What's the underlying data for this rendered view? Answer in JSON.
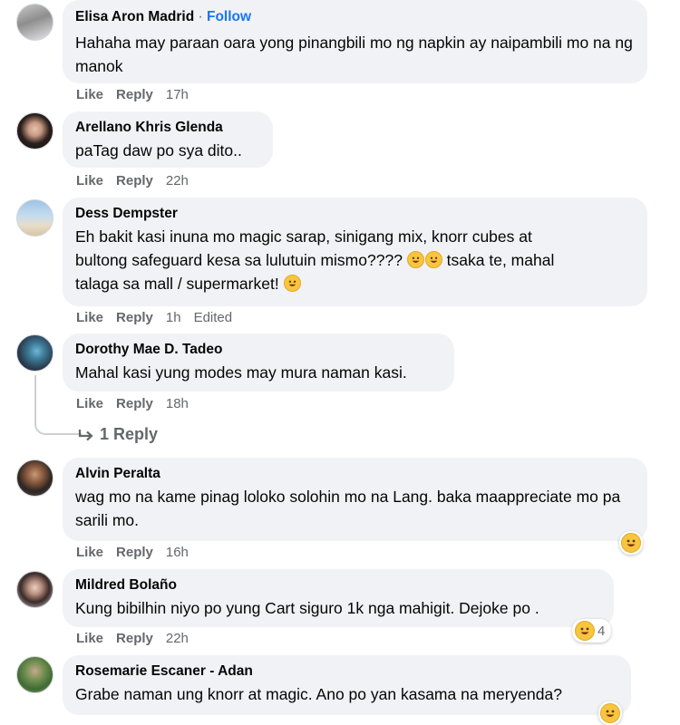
{
  "comments": [
    {
      "author": "Elisa Aron Madrid",
      "follow": "Follow",
      "text": "Hahaha may paraan oara yong pinangbili mo ng napkin ay naipambili mo na ng manok",
      "like": "Like",
      "reply": "Reply",
      "time": "17h"
    },
    {
      "author": "Arellano Khris Glenda",
      "text": "paTag daw po sya dito..",
      "like": "Like",
      "reply": "Reply",
      "time": "22h"
    },
    {
      "author": "Dess Dempster",
      "text_line1": "Eh bakit kasi inuna mo magic sarap, sinigang mix, knorr cubes at",
      "text_line2": "bultong safeguard kesa sa lulutuin mismo????",
      "text_line2b": "tsaka te, mahal",
      "text_line3": "talaga sa mall / supermarket!",
      "like": "Like",
      "reply": "Reply",
      "time": "1h",
      "edited": "Edited"
    },
    {
      "author": "Dorothy Mae D. Tadeo",
      "text": "Mahal kasi yung modes may mura naman kasi.",
      "like": "Like",
      "reply": "Reply",
      "time": "18h",
      "replies_link": "1 Reply"
    },
    {
      "author": "Alvin Peralta",
      "text": "wag mo na kame pinag loloko solohin mo na Lang. baka maappreciate mo pa sarili mo.",
      "like": "Like",
      "reply": "Reply",
      "time": "16h",
      "reaction_icon": "laughing-emoji-icon"
    },
    {
      "author": "Mildred Bolaño",
      "text": "Kung bibilhin niyo po yung Cart siguro 1k nga mahigit. Dejoke po .",
      "like": "Like",
      "reply": "Reply",
      "time": "22h",
      "reaction_icon": "laughing-emoji-icon",
      "reaction_count": "4"
    },
    {
      "author": "Rosemarie Escaner - Adan",
      "text": "Grabe naman ung knorr at magic. Ano po yan kasama na meryenda?"
    }
  ],
  "colors": {
    "bubble": "#f0f2f5",
    "link": "#1877f2",
    "meta": "#65676b",
    "emoji": "#f7c53e"
  }
}
